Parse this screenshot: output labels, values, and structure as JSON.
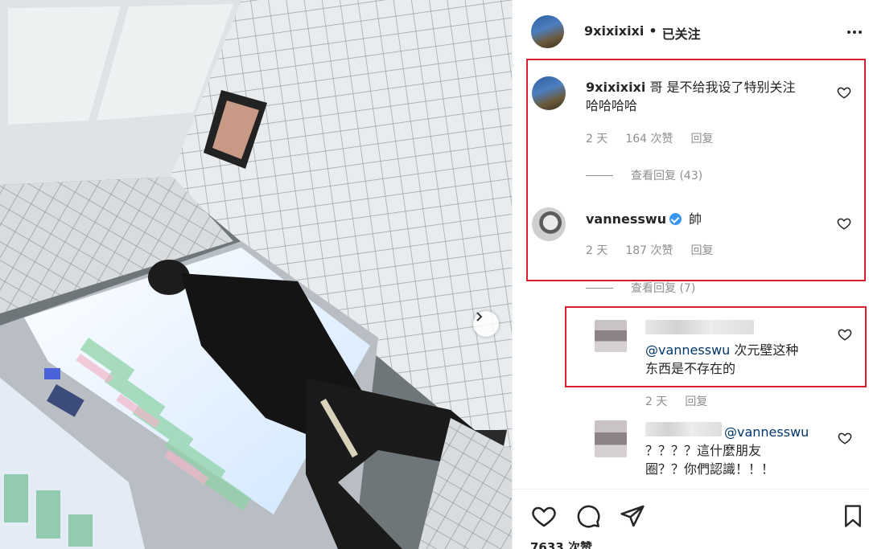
{
  "post": {
    "author": "9xixixixi",
    "separator": "•",
    "follow_state": "已关注",
    "more_icon": "more-horizontal-icon"
  },
  "comments": [
    {
      "username": "9xixixixi",
      "text_line1": "哥 是不给我设了特别关注",
      "text_line2": "哈哈哈哈",
      "time": "2 天",
      "likes": "164 次赞",
      "reply": "回复",
      "view_replies": "查看回复 (43)"
    },
    {
      "username": "vannesswu",
      "text": "帥",
      "time": "2 天",
      "likes": "187 次赞",
      "reply": "回复",
      "view_replies": "查看回复 (7)"
    }
  ],
  "replies": [
    {
      "mention": "@vannesswu",
      "text_line1": " 次元壁这种",
      "text_line2": "东西是不存在的",
      "time": "2 天",
      "reply": "回复"
    },
    {
      "mention": "@vannesswu",
      "text_line1": "？？？？這什麼朋友",
      "text_line2": "圈？？你們認識！！！"
    }
  ],
  "actions": {
    "like_icon": "heart-icon",
    "comment_icon": "comment-icon",
    "share_icon": "send-icon",
    "save_icon": "bookmark-icon",
    "likes_count": "7633 次赞"
  },
  "colors": {
    "highlight_box": "#d81e2c",
    "verified_badge": "#3897f0",
    "mention": "#00376b"
  }
}
